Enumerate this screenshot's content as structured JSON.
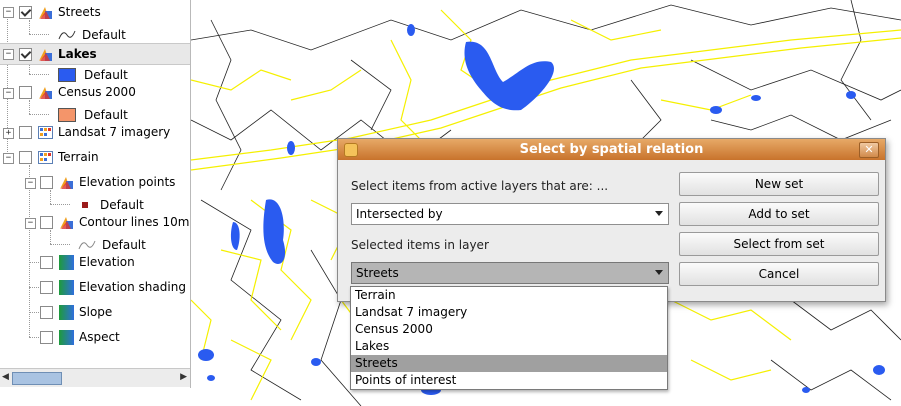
{
  "layers_panel": {
    "items": [
      {
        "label": "Streets",
        "checked": true,
        "icon": "vector-layer-icon",
        "legend": {
          "label": "Default",
          "icon": "line-symbol-icon"
        }
      },
      {
        "label": "Lakes",
        "checked": true,
        "icon": "vector-layer-icon",
        "selected": true,
        "legend": {
          "label": "Default",
          "color": "#2a5bf0"
        }
      },
      {
        "label": "Census 2000",
        "checked": false,
        "icon": "vector-layer-icon",
        "legend": {
          "label": "Default",
          "color": "#f4956a"
        }
      },
      {
        "label": "Landsat 7 imagery",
        "checked": false,
        "icon": "raster-layer-icon"
      },
      {
        "label": "Terrain",
        "checked": false,
        "icon": "raster-layer-icon",
        "children": [
          {
            "label": "Elevation points",
            "checked": false,
            "icon": "vector-layer-icon",
            "legend": {
              "label": "Default",
              "color": "#9b1c1c"
            }
          },
          {
            "label": "Contour lines 10m",
            "checked": false,
            "icon": "vector-layer-icon",
            "legend": {
              "label": "Default",
              "icon": "line-symbol-icon"
            }
          },
          {
            "label": "Elevation",
            "checked": false,
            "icon": "gradient-raster-icon"
          },
          {
            "label": "Elevation shading",
            "checked": false,
            "icon": "gradient-raster-icon"
          },
          {
            "label": "Slope",
            "checked": false,
            "icon": "gradient-raster-icon"
          },
          {
            "label": "Aspect",
            "checked": false,
            "icon": "gradient-raster-icon"
          }
        ]
      }
    ]
  },
  "colors": {
    "streets": "#f5f000",
    "water": "#2a5bf0",
    "roads": "#000000",
    "title_bar": "#d68a44"
  },
  "dialog": {
    "title": "Select by spatial relation",
    "prompt": "Select items from active layers that are: ...",
    "relation_value": "Intersected by",
    "layer_label": "Selected items in layer",
    "layer_value": "Streets",
    "buttons": {
      "new_set": "New set",
      "add_to_set": "Add to set",
      "select_from_set": "Select from set",
      "cancel": "Cancel"
    },
    "dropdown_options": [
      "Terrain",
      "Landsat 7 imagery",
      "Census 2000",
      "Lakes",
      "Streets",
      "Points of interest"
    ],
    "highlighted_option": "Streets"
  }
}
